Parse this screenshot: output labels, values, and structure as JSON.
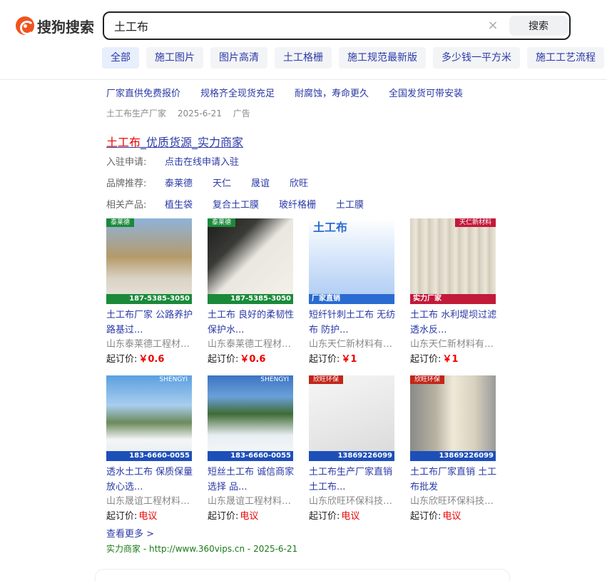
{
  "header": {
    "logo_text": "搜狗搜索",
    "search_value": "土工布",
    "clear_icon": "×",
    "search_button": "搜索"
  },
  "tabs": [
    "全部",
    "施工图片",
    "图片高清",
    "土工格栅",
    "施工规范最新版",
    "多少钱一平方米",
    "施工工艺流程"
  ],
  "ad": {
    "links": [
      "厂家直供免费报价",
      "规格齐全现货充足",
      "耐腐蚀，寿命更久",
      "全国发货可带安装"
    ],
    "meta": [
      "土工布生产厂家",
      "2025-6-21",
      "广告"
    ]
  },
  "result": {
    "title_highlight": "土工布",
    "title_rest": "_优质货源_实力商家",
    "apply_label": "入驻申请:",
    "apply_link": "点击在线申请入驻",
    "brand_label": "品牌推荐:",
    "brands": [
      "泰莱德",
      "天仁",
      "晟谊",
      "欣旺"
    ],
    "product_label": "相关产品:",
    "products": [
      "植生袋",
      "复合土工膜",
      "玻纤格栅",
      "土工膜"
    ],
    "price_label": "起订价:",
    "items": [
      {
        "title": "土工布厂家 公路养护路基过...",
        "company": "山东泰莱德工程材料有限公司",
        "price": "￥0.6",
        "tag": "泰莱德",
        "bar": "187-5385-3050",
        "color": "#1a8a3a"
      },
      {
        "title": "土工布 良好的柔韧性 保护水...",
        "company": "山东泰莱德工程材料有限公司",
        "price": "￥0.6",
        "tag": "泰莱德",
        "bar": "187-5385-3050",
        "color": "#1a8a3a"
      },
      {
        "title": "短纤针刺土工布 无纺布 防护...",
        "company": "山东天仁新材料有限公司",
        "price": "￥1",
        "tag": "土工布",
        "bar": "厂家直销",
        "color": "#2a6bd1"
      },
      {
        "title": "土工布 水利堤坝过滤透水反...",
        "company": "山东天仁新材料有限公司",
        "price": "￥1",
        "tag": "天仁新材料",
        "bar": "实力厂家",
        "color": "#c21a3a"
      },
      {
        "title": "透水土工布 保质保量放心选...",
        "company": "山东晟谊工程材料有限公司",
        "price": "电议",
        "tag": "SHENGYI",
        "bar": "183-6660-0055",
        "color": "#1d4fb8"
      },
      {
        "title": "短丝土工布 诚信商家选择 品...",
        "company": "山东晟谊工程材料有限公司",
        "price": "电议",
        "tag": "SHENGYI",
        "bar": "183-6660-0055",
        "color": "#1d4fb8"
      },
      {
        "title": "土工布生产厂家直销 土工布...",
        "company": "山东欣旺环保科技有限公司",
        "price": "电议",
        "tag": "欣旺环保",
        "bar": "13869226099",
        "color": "#c2261a"
      },
      {
        "title": "土工布厂家直销 土工布批发",
        "company": "山东欣旺环保科技有限公司",
        "price": "电议",
        "tag": "欣旺环保",
        "bar": "13869226099",
        "color": "#c2261a"
      }
    ],
    "more_label": "查看更多 >",
    "source": "实力商家 - http://www.360vips.cn - 2025-6-21"
  }
}
